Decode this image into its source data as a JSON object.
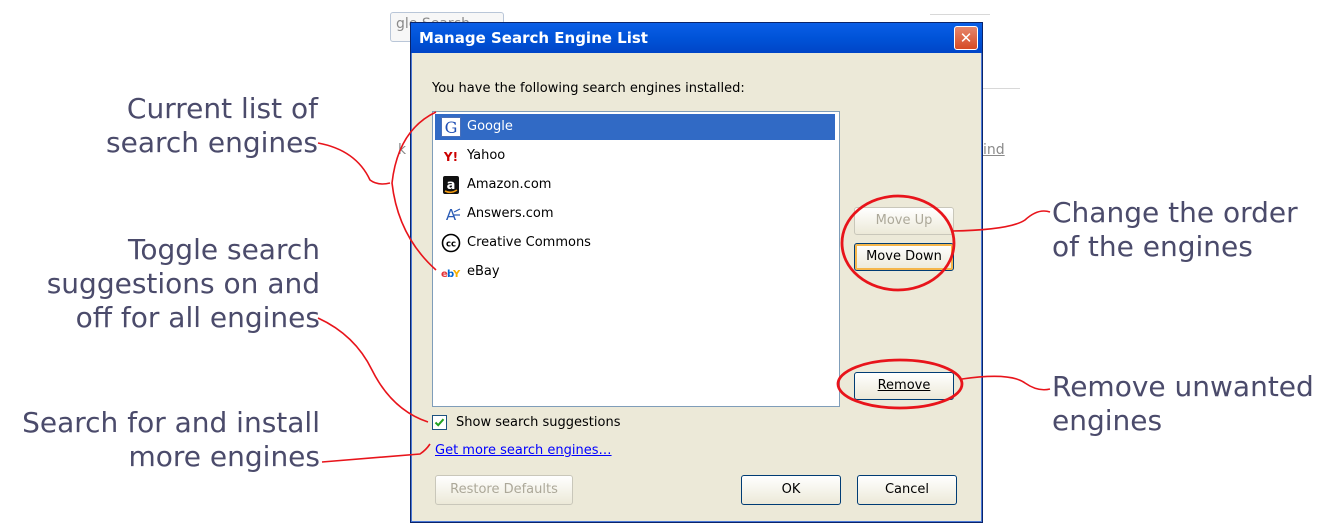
{
  "background": {
    "fragment_search": "gle Search",
    "fragment_left": "k",
    "fragment_right": "ind"
  },
  "annotations": {
    "current_list": "Current list of\nsearch engines",
    "toggle_suggestions": "Toggle search\nsuggestions on and\noff for all engines",
    "search_install": "Search for and install\nmore engines",
    "change_order": "Change the order\nof the engines",
    "remove_unwanted": "Remove unwanted\nengines"
  },
  "dialog": {
    "title": "Manage Search Engine List",
    "close_label": "✕",
    "intro": "You have the following search engines installed:",
    "engines": [
      {
        "label": "Google",
        "icon": "google-icon",
        "selected": true
      },
      {
        "label": "Yahoo",
        "icon": "yahoo-icon",
        "selected": false
      },
      {
        "label": "Amazon.com",
        "icon": "amazon-icon",
        "selected": false
      },
      {
        "label": "Answers.com",
        "icon": "answers-icon",
        "selected": false
      },
      {
        "label": "Creative Commons",
        "icon": "creative-commons-icon",
        "selected": false
      },
      {
        "label": "eBay",
        "icon": "ebay-icon",
        "selected": false
      }
    ],
    "move_up": "Move Up",
    "move_down": "Move Down",
    "remove": "Remove",
    "show_suggestions": "Show search suggestions",
    "show_suggestions_checked": true,
    "get_more": "Get more search engines…",
    "restore_defaults": "Restore Defaults",
    "ok": "OK",
    "cancel": "Cancel"
  },
  "colors": {
    "annotation_text": "#4b4b6b",
    "highlight_red": "#e8141b",
    "titlebar_blue": "#0053d8",
    "selection_blue": "#316ac5"
  }
}
